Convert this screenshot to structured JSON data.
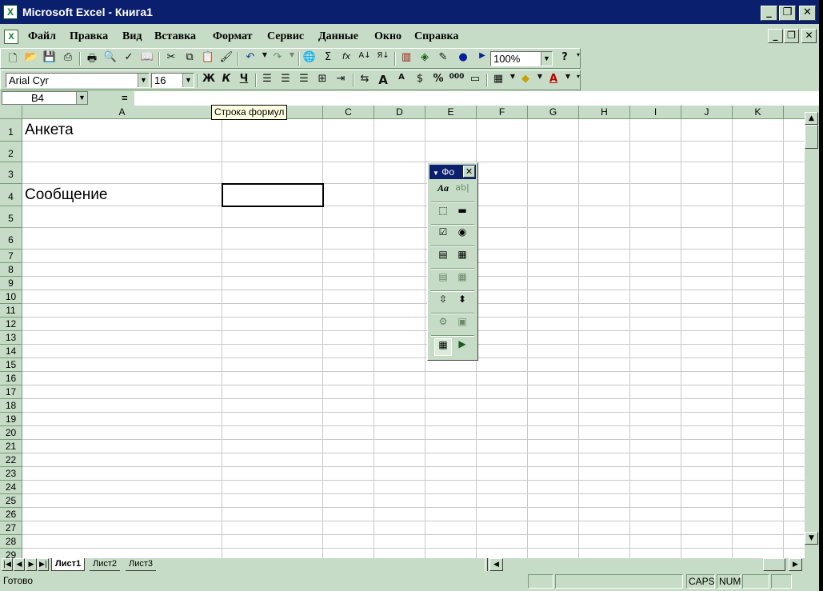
{
  "window": {
    "title": "Microsoft Excel - Книга1",
    "icon": "excel-icon"
  },
  "menu": {
    "items": [
      "Файл",
      "Правка",
      "Вид",
      "Вставка",
      "Формат",
      "Сервис",
      "Данные",
      "Окно",
      "Справка"
    ]
  },
  "standard_toolbar": {
    "zoom": "100%"
  },
  "format_toolbar": {
    "font": "Arial Cyr",
    "size": "16",
    "bold": "Ж",
    "italic": "К",
    "underline": "Ч"
  },
  "formula_bar": {
    "name_box": "B4",
    "equals": "=",
    "value": ""
  },
  "tooltip": "Строка формул",
  "columns": [
    "A",
    "B",
    "C",
    "D",
    "E",
    "F",
    "G",
    "H",
    "I",
    "J",
    "K"
  ],
  "rows": [
    "1",
    "2",
    "3",
    "4",
    "5",
    "6",
    "7",
    "8",
    "9",
    "10",
    "11",
    "12",
    "13",
    "14",
    "15",
    "16",
    "17",
    "18",
    "19",
    "20",
    "21",
    "22",
    "23",
    "24",
    "25",
    "26",
    "27",
    "28",
    "29"
  ],
  "cells": {
    "A1": "Анкета",
    "A4": "Сообщение"
  },
  "selected_cell": "B4",
  "forms_panel": {
    "title": "Фо"
  },
  "sheets": [
    "Лист1",
    "Лист2",
    "Лист3"
  ],
  "active_sheet": "Лист1",
  "status": {
    "text": "Готово",
    "caps": "CAPS",
    "num": "NUM"
  }
}
